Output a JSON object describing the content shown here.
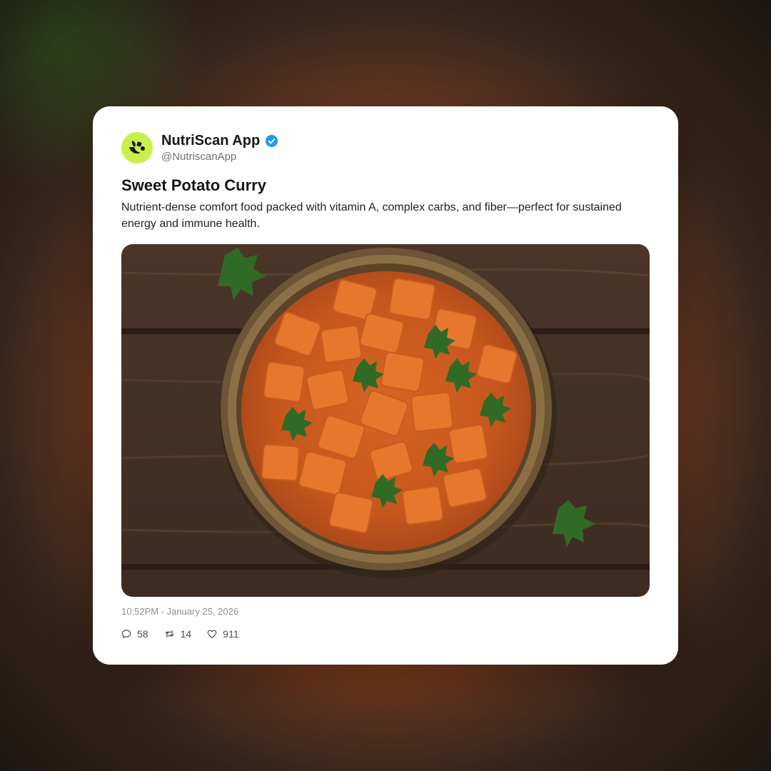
{
  "account": {
    "name": "NutriScan App",
    "handle": "@NutriscanApp",
    "verified": true,
    "avatar_color": "#c9ef4b",
    "verified_color": "#1d9bf0"
  },
  "post": {
    "title": "Sweet Potato Curry",
    "description": "Nutrient-dense comfort food packed with vitamin A, complex carbs, and fiber—perfect for sustained energy and immune health.",
    "image_icon": "sweet-potato-curry-bowl",
    "timestamp": "10:52PM - January 25, 2026"
  },
  "actions": {
    "replies": "58",
    "reposts": "14",
    "likes": "911"
  }
}
